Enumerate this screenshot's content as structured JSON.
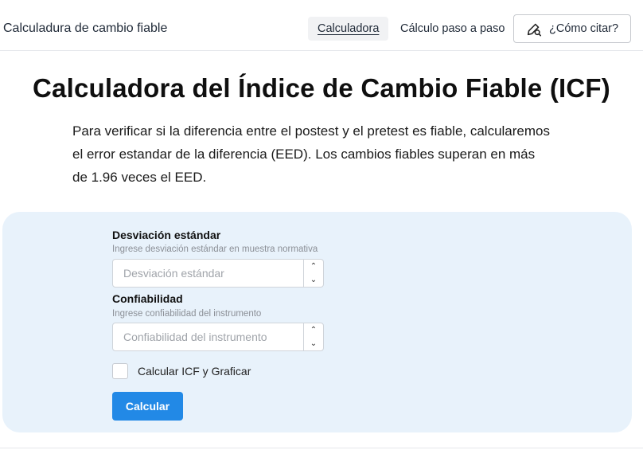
{
  "navbar": {
    "brand": "Calculadura de cambio fiable",
    "links": [
      {
        "label": "Calculadora"
      },
      {
        "label": "Cálculo paso a paso"
      }
    ],
    "cite_label": "¿Cómo citar?",
    "cite_icon": "quote-search-icon"
  },
  "main": {
    "title": "Calculadora del Índice de Cambio Fiable (ICF)",
    "intro": "Para verificar si la diferencia entre el postest y el pretest es fiable, calcularemos el error estandar de la diferencia (EED). Los cambios fiables superan en más de 1.96 veces el EED."
  },
  "form": {
    "fields": [
      {
        "label": "Desviación estándar",
        "help": "Ingrese desviación estándar en muestra normativa",
        "placeholder": "Desviación estándar",
        "value": ""
      },
      {
        "label": "Confiabilidad",
        "help": "Ingrese confiabilidad del instrumento",
        "placeholder": "Confiabilidad del instrumento",
        "value": ""
      }
    ],
    "checkbox_label": "Calcular ICF y Graficar",
    "checkbox_checked": false,
    "submit_label": "Calcular"
  },
  "colors": {
    "accent": "#2289e6",
    "panel_bg": "#e8f2fb"
  }
}
